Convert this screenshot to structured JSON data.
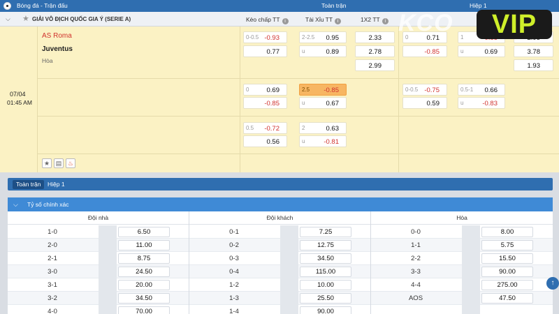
{
  "header": {
    "title": "Bóng đá - Trận đấu",
    "full_time": "Toàn trận",
    "first_half": "Hiệp 1"
  },
  "league": {
    "name": "GIẢI VÔ ĐỊCH QUỐC GIA Ý (SERIE A)",
    "col_handicap": "Kèo chấp TT",
    "col_overunder": "Tài Xỉu TT",
    "col_1x2": "1X2 TT"
  },
  "match": {
    "date": "07/04",
    "time": "01:45 AM",
    "home": "AS Roma",
    "away": "Juventus",
    "draw": "Hòa",
    "full": {
      "row1": {
        "hcp_line": "0-0.5",
        "hcp_home": "-0.93",
        "hcp_away": "0.77",
        "ou_line": "2-2.5",
        "ou_over": "0.95",
        "ou_under_tag": "u",
        "ou_under": "0.89",
        "x_home": "2.33",
        "x_away": "2.78",
        "x_draw": "2.99"
      },
      "row2": {
        "hcp_line": "0",
        "hcp_home": "0.69",
        "hcp_away": "-0.85",
        "ou_line": "2.5",
        "ou_over": "-0.85",
        "ou_under_tag": "u",
        "ou_under": "0.67"
      },
      "row3": {
        "hcp_line": "0.5",
        "hcp_home": "-0.72",
        "hcp_away": "0.56",
        "ou_line": "2",
        "ou_over": "0.63",
        "ou_under_tag": "u",
        "ou_under": "-0.81"
      }
    },
    "half": {
      "row1": {
        "hcp_line": "0",
        "hcp_home": "0.71",
        "hcp_away": "-0.85",
        "ou_line": "1",
        "ou_over": "-0.85",
        "ou_under_tag": "u",
        "ou_under": "0.69",
        "x_home": "2.95",
        "x_away": "3.78",
        "x_draw": "1.93"
      },
      "row2": {
        "hcp_line": "0-0.5",
        "hcp_home": "-0.75",
        "hcp_away": "0.59",
        "ou_line": "0.5-1",
        "ou_over": "0.66",
        "ou_under_tag": "u",
        "ou_under": "-0.83"
      }
    }
  },
  "watermark": {
    "ghost": "KCO",
    "vip": "VIP"
  },
  "tabs": [
    "Toàn trận",
    "Hiệp 1"
  ],
  "correct_score": {
    "title": "Tỷ số chính xác",
    "headers": [
      "Đội nhà",
      "Đội khách",
      "Hòa"
    ],
    "rows": [
      {
        "h_score": "1-0",
        "h_odds": "6.50",
        "a_score": "0-1",
        "a_odds": "7.25",
        "d_score": "0-0",
        "d_odds": "8.00"
      },
      {
        "h_score": "2-0",
        "h_odds": "11.00",
        "a_score": "0-2",
        "a_odds": "12.75",
        "d_score": "1-1",
        "d_odds": "5.75"
      },
      {
        "h_score": "2-1",
        "h_odds": "8.75",
        "a_score": "0-3",
        "a_odds": "34.50",
        "d_score": "2-2",
        "d_odds": "15.50"
      },
      {
        "h_score": "3-0",
        "h_odds": "24.50",
        "a_score": "0-4",
        "a_odds": "115.00",
        "d_score": "3-3",
        "d_odds": "90.00"
      },
      {
        "h_score": "3-1",
        "h_odds": "20.00",
        "a_score": "1-2",
        "a_odds": "10.00",
        "d_score": "4-4",
        "d_odds": "275.00"
      },
      {
        "h_score": "3-2",
        "h_odds": "34.50",
        "a_score": "1-3",
        "a_odds": "25.50",
        "d_score": "AOS",
        "d_odds": "47.50"
      },
      {
        "h_score": "4-0",
        "h_odds": "70.00",
        "a_score": "1-4",
        "a_odds": "90.00",
        "d_score": "",
        "d_odds": ""
      }
    ]
  },
  "colors": {
    "header_blue": "#2f6eb0",
    "match_bg": "#fbf2c4",
    "negative": "#d0312d",
    "highlight": "#f7b662"
  }
}
